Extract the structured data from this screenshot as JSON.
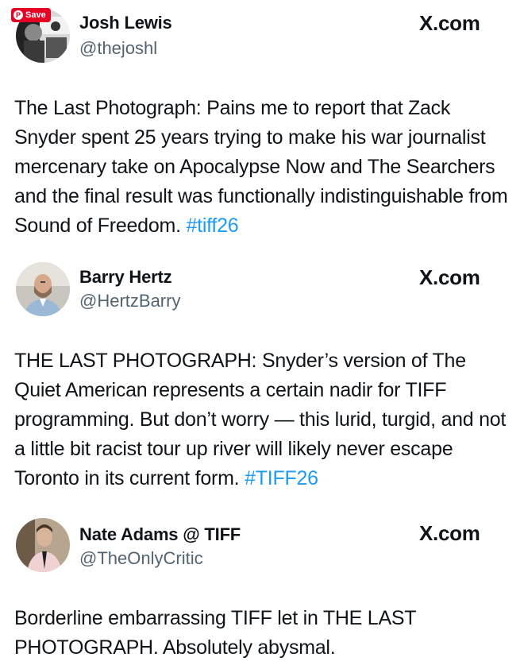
{
  "pinterest": {
    "save_label": "Save",
    "icon": "pinterest-p-icon",
    "color": "#e60023"
  },
  "tweets": [
    {
      "name": "Josh Lewis",
      "handle": "@thejoshl",
      "source": "X.com",
      "text": "The Last Photograph: Pains me to report that Zack Snyder spent 25 years trying to make his war journalist mercenary take on Apocalypse Now and The Searchers and the final result was functionally indistinguishable from Sound of Freedom.",
      "hashtag": "#tiff26"
    },
    {
      "name": "Barry Hertz",
      "handle": "@HertzBarry",
      "source": "X.com",
      "text": "THE LAST PHOTOGRAPH: Snyder’s version of The Quiet American represents a certain nadir for TIFF programming. But don’t worry — this lurid, turgid, and not a little bit racist tour up river will likely never escape Toronto in its current form.",
      "hashtag": "#TIFF26"
    },
    {
      "name": "Nate Adams @ TIFF",
      "handle": "@TheOnlyCritic",
      "source": "X.com",
      "text": "Borderline embarrassing TIFF let in THE LAST PHOTOGRAPH. Absolutely abysmal.",
      "hashtag": ""
    }
  ],
  "colors": {
    "text": "#0f1419",
    "handle": "#536471",
    "hashtag": "#1d9bf0"
  }
}
